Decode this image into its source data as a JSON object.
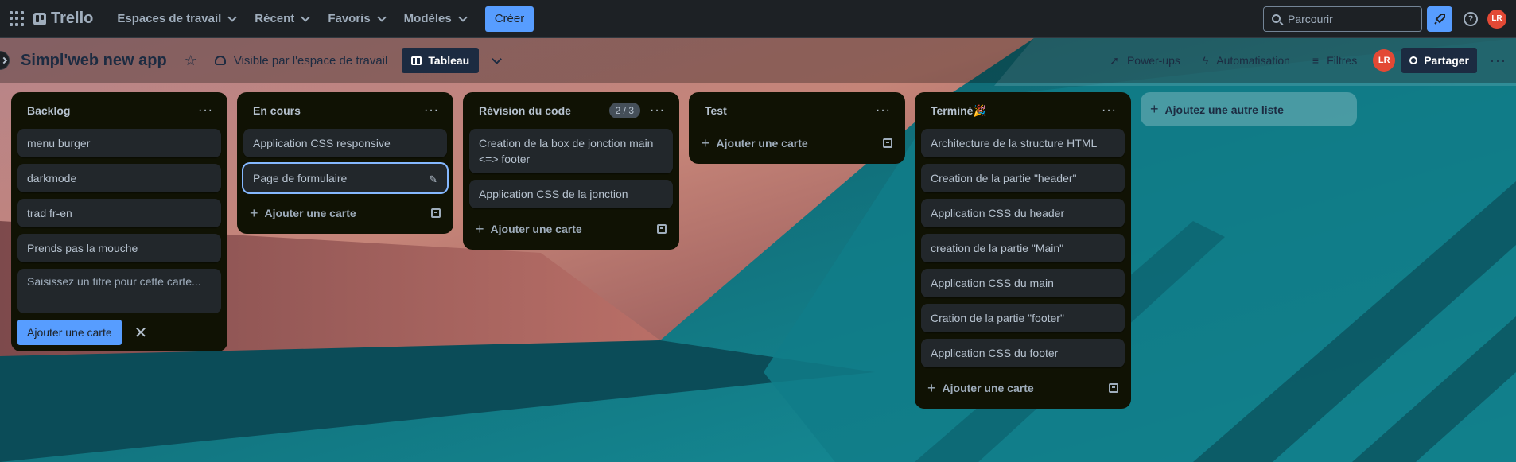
{
  "topnav": {
    "brand": "Trello",
    "menus": [
      {
        "label": "Espaces de travail"
      },
      {
        "label": "Récent"
      },
      {
        "label": "Favoris"
      },
      {
        "label": "Modèles"
      }
    ],
    "create_label": "Créer",
    "search_placeholder": "Parcourir",
    "user_initials": "LR"
  },
  "board": {
    "title": "Simpl'web new app",
    "visibility": "Visible par l'espace de travail",
    "view_label": "Tableau",
    "powerups": "Power-ups",
    "automation": "Automatisation",
    "filters": "Filtres",
    "member_initials": "LR",
    "share_label": "Partager",
    "add_list": "Ajoutez une autre liste",
    "colors": {
      "accent": "#579dff",
      "list_bg": "#101204",
      "card_bg": "#22272b",
      "avatar": "#e34935"
    }
  },
  "lists": [
    {
      "title": "Backlog",
      "cards": [
        "menu burger",
        "darkmode",
        "trad fr-en",
        "Prends pas la mouche"
      ],
      "composer_placeholder": "Saisissez un titre pour cette carte...",
      "composer_button": "Ajouter une carte"
    },
    {
      "title": "En cours",
      "cards": [
        "Application CSS responsive",
        "Page de formulaire"
      ],
      "add_card": "Ajouter une carte"
    },
    {
      "title": "Révision du code",
      "count": "2 / 3",
      "cards": [
        "Creation de la box de jonction main <=> footer",
        "Application CSS de la jonction"
      ],
      "add_card": "Ajouter une carte"
    },
    {
      "title": "Test",
      "cards": [],
      "add_card": "Ajouter une carte"
    },
    {
      "title": "Terminé🎉",
      "cards": [
        "Architecture de la structure HTML",
        "Creation de la partie \"header\"",
        "Application CSS du header",
        "creation de la partie \"Main\"",
        "Application CSS du main",
        "Cration de la partie \"footer\"",
        "Application CSS du footer"
      ],
      "add_card": "Ajouter une carte"
    }
  ]
}
